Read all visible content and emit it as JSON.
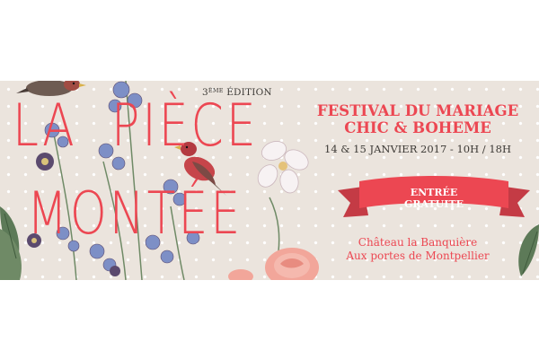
{
  "banner": {
    "title_line1_left": "LA",
    "title_line1_right": "PIÈCE",
    "title_line2": "MONTÉE",
    "edition_number": "3",
    "edition_suffix": "ÈME",
    "edition_word": "ÉDITION",
    "festival_line1": "FESTIVAL DU MARIAGE",
    "festival_line2": "CHIC & BOHEME",
    "dates": "14 & 15 JANVIER 2017 - 10H / 18H",
    "entry_line1": "ENTRÉE",
    "entry_line2": "GRATUITE",
    "place_line1": "Château la Banquière",
    "place_line2": "Aux portes de Montpellier"
  },
  "colors": {
    "accent": "#ec4752",
    "background": "#ebe4dd",
    "text_dark": "#3d3a36",
    "flower_blue": "#7d8fc6",
    "flower_purple": "#5b4a6e",
    "leaf_green": "#5d7a58",
    "rose_pink": "#f2a69a"
  },
  "decorations": [
    "bird-left",
    "bird-center",
    "blue-flowers",
    "white-flower",
    "pink-rose",
    "leaves-left",
    "leaves-right"
  ]
}
